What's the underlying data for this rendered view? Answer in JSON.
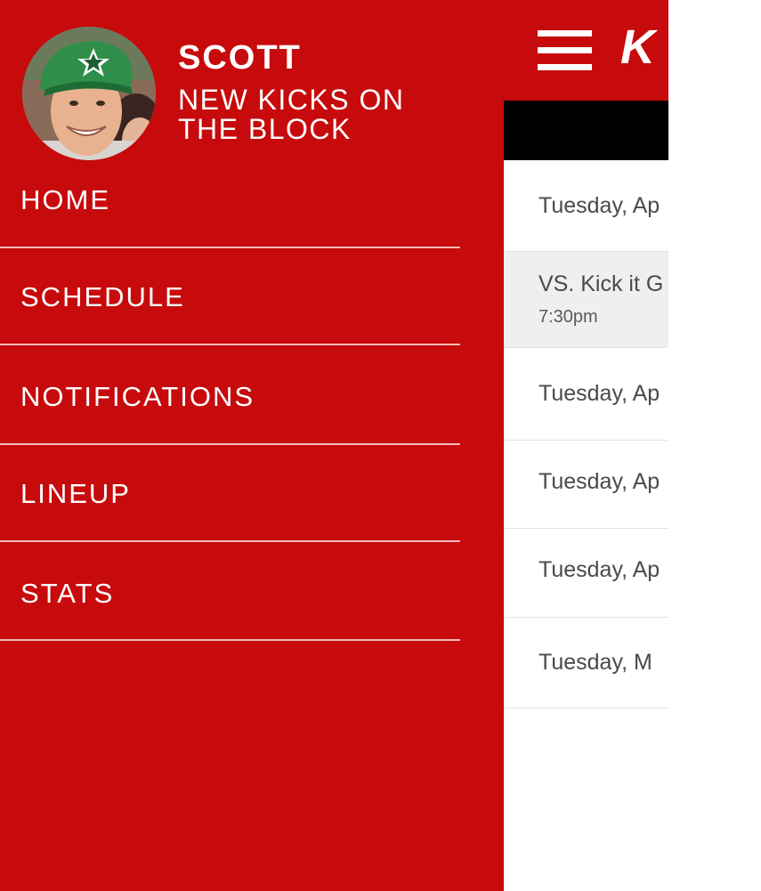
{
  "colors": {
    "brand_red": "#c70a0c",
    "header_black": "#000000",
    "row_highlight": "#efefef",
    "text_gray": "#4a4a4a",
    "divider": "#f2b9b9"
  },
  "drawer": {
    "user_name": "SCOTT",
    "team_name": "NEW KICKS ON THE BLOCK",
    "avatar_icon": "user-photo",
    "nav": [
      {
        "label": "HOME"
      },
      {
        "label": "SCHEDULE"
      },
      {
        "label": "NOTIFICATIONS"
      },
      {
        "label": "LINEUP"
      },
      {
        "label": "STATS"
      }
    ]
  },
  "app": {
    "menu_icon": "hamburger-menu-icon",
    "logo_text": "K",
    "schedule": [
      {
        "text": "Tuesday, Ap"
      },
      {
        "opponent": "VS. Kick it G",
        "time": "7:30pm"
      },
      {
        "text": "Tuesday, Ap"
      },
      {
        "text": "Tuesday, Ap"
      },
      {
        "text": "Tuesday, Ap"
      },
      {
        "text": "Tuesday, M"
      }
    ]
  }
}
